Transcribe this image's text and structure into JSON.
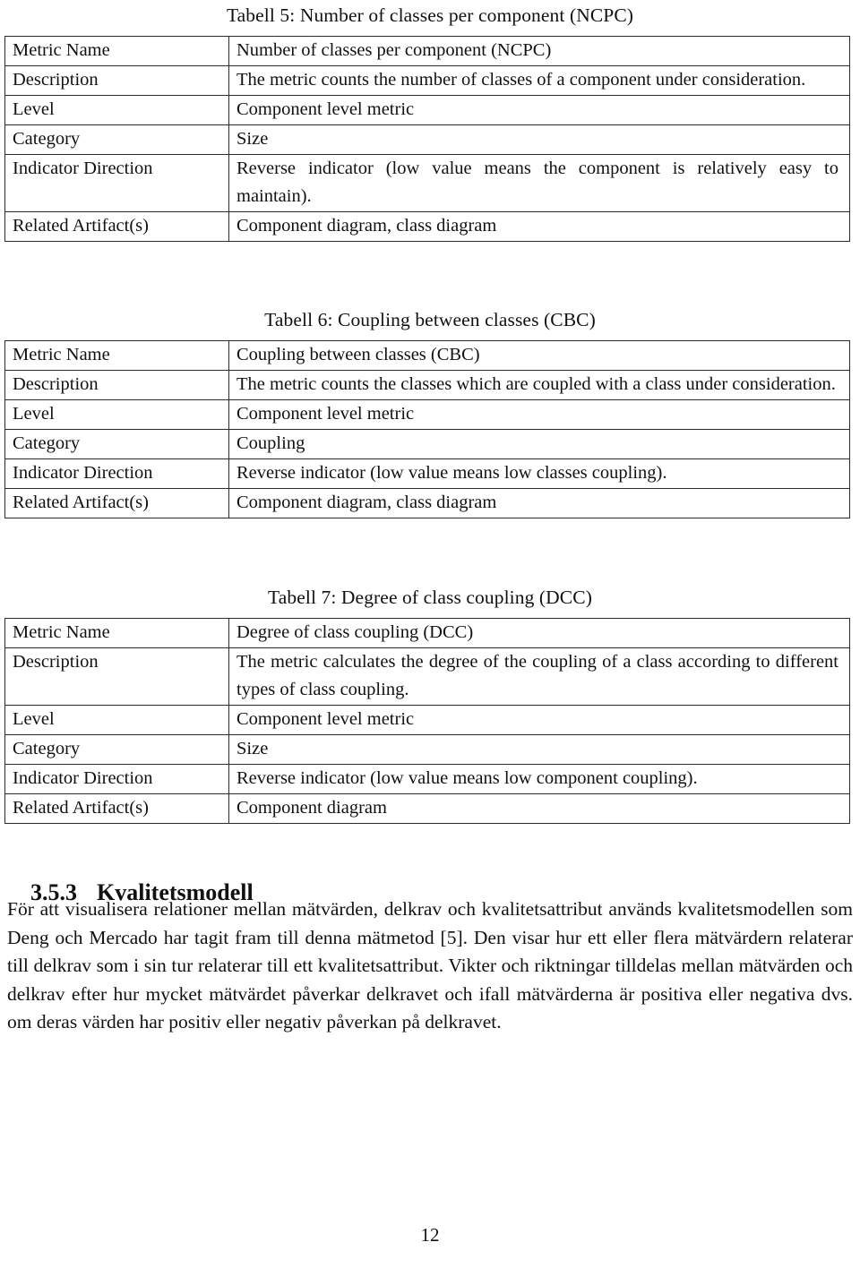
{
  "document": {
    "page_number": "12",
    "row_labels": {
      "metric_name": "Metric Name",
      "description": "Description",
      "level": "Level",
      "category": "Category",
      "indicator_direction": "Indicator Direction",
      "related_artifacts": "Related Artifact(s)"
    }
  },
  "tables": [
    {
      "caption": "Tabell 5: Number of classes per component (NCPC)",
      "labels": {
        "metric_name": "Metric Name",
        "description": "Description",
        "level": "Level",
        "category": "Category",
        "indicator_direction": "Indicator Direction",
        "related_artifacts": "Related Artifact(s)"
      },
      "values": {
        "metric_name": "Number of classes per component (NCPC)",
        "description": "The metric counts the number of classes of a component under consideration.",
        "level": "Component level metric",
        "category": "Size",
        "indicator_direction": "Reverse indicator (low value means the component is relatively easy to maintain).",
        "related_artifacts": "Component diagram, class diagram"
      }
    },
    {
      "caption": "Tabell 6: Coupling between classes (CBC)",
      "labels": {
        "metric_name": "Metric Name",
        "description": "Description",
        "level": "Level",
        "category": "Category",
        "indicator_direction": "Indicator Direction",
        "related_artifacts": "Related Artifact(s)"
      },
      "values": {
        "metric_name": "Coupling between classes (CBC)",
        "description": "The metric counts the classes which are coupled with a class under consideration.",
        "level": "Component level metric",
        "category": "Coupling",
        "indicator_direction": "Reverse indicator (low value means low classes coupling).",
        "related_artifacts": "Component diagram, class diagram"
      }
    },
    {
      "caption": "Tabell 7: Degree of class coupling (DCC)",
      "labels": {
        "metric_name": "Metric Name",
        "description": "Description",
        "level": "Level",
        "category": "Category",
        "indicator_direction": "Indicator Direction",
        "related_artifacts": "Related Artifact(s)"
      },
      "values": {
        "metric_name": "Degree of class coupling (DCC)",
        "description": "The metric calculates the degree of the coupling of a class according to different types of class coupling.",
        "level": "Component level metric",
        "category": "Size",
        "indicator_direction": "Reverse indicator (low value means low component coupling).",
        "related_artifacts": "Component diagram"
      }
    }
  ],
  "section": {
    "number": "3.5.3",
    "title": "Kvalitetsmodell",
    "paragraph": "För att visualisera relationer mellan mätvärden, delkrav och kvalitetsattribut används kvalitetsmodellen som Deng och Mercado har tagit fram till denna mätmetod [5]. Den visar hur ett eller flera mätvärdern relaterar till delkrav som i sin tur relaterar till ett kvalitetsattribut. Vikter och riktningar tilldelas mellan mätvärden och delkrav efter hur mycket mätvärdet påverkar delkravet och ifall mätvärderna är positiva eller negativa dvs. om deras värden har positiv eller negativ påverkan på delkravet."
  }
}
